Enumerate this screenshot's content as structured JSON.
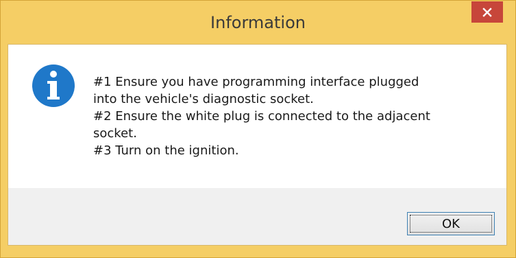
{
  "window": {
    "title": "Information",
    "accent_color": "#f5ce65",
    "close_color": "#c7463a"
  },
  "dialog": {
    "icon": "info-icon",
    "message_lines": [
      "#1 Ensure you have programming interface plugged",
      "into the vehicle's diagnostic socket.",
      "#2 Ensure the white plug is connected to the adjacent",
      "socket.",
      "#3 Turn on the ignition."
    ],
    "ok_label": "OK"
  }
}
